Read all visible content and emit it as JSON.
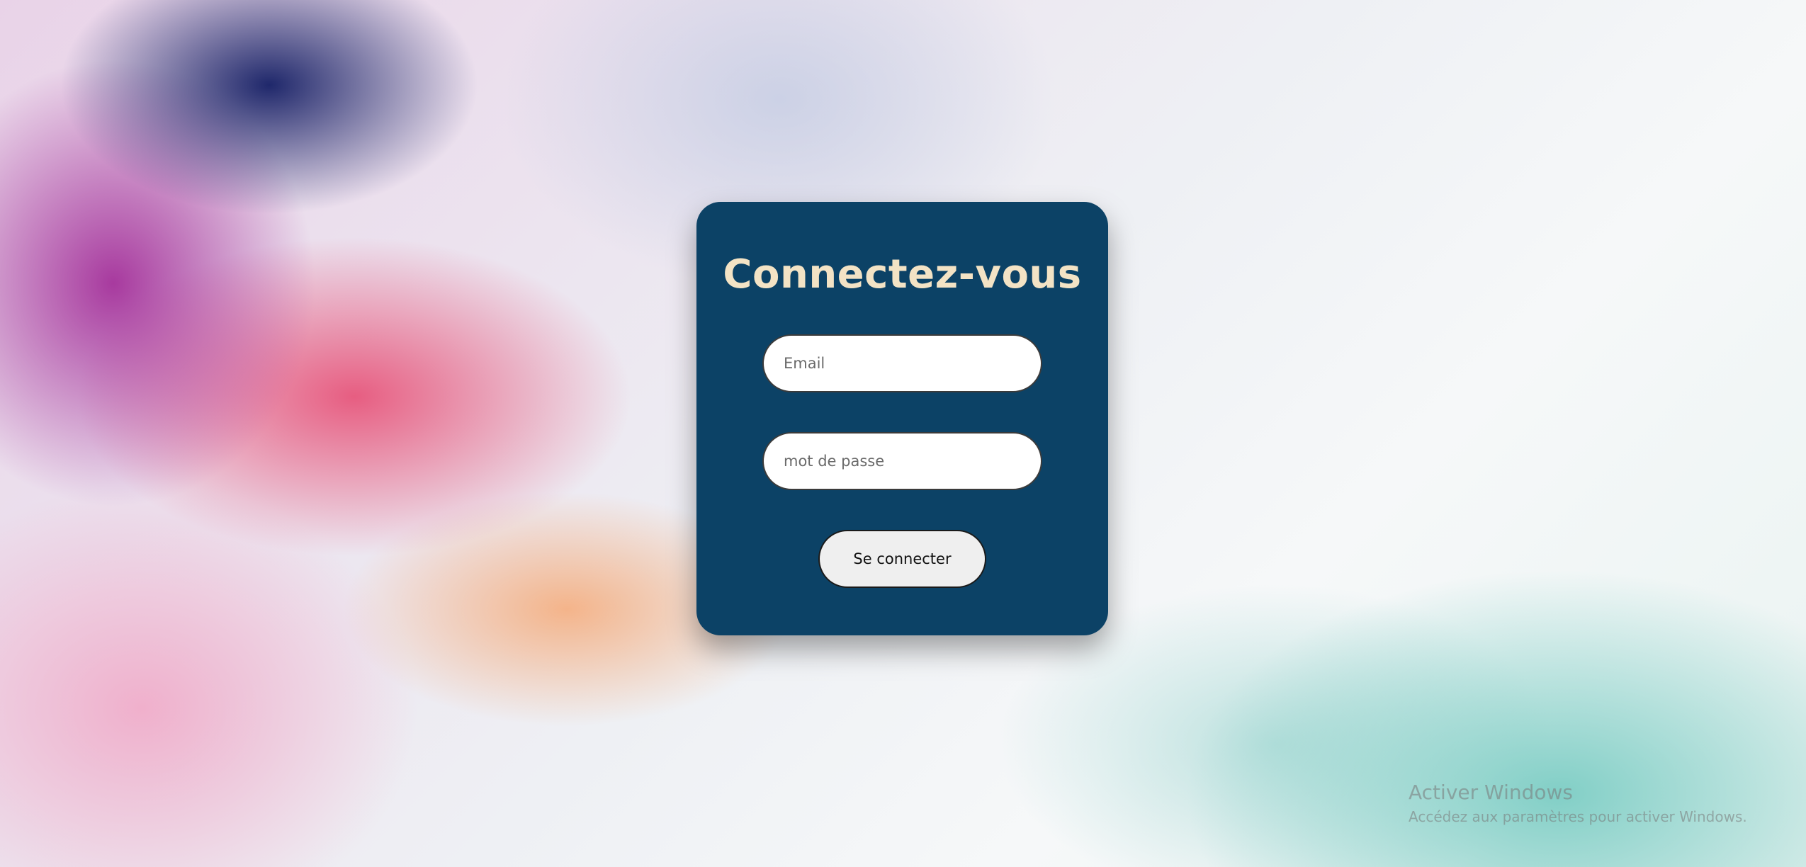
{
  "login": {
    "title": "Connectez-vous",
    "email_placeholder": "Email",
    "password_placeholder": "mot de passe",
    "submit_label": "Se connecter"
  },
  "watermark": {
    "title": "Activer Windows",
    "subtitle": "Accédez aux paramètres pour activer Windows."
  },
  "colors": {
    "card": "#0c4266",
    "title": "#f3e3c5",
    "button_bg": "#efefef"
  }
}
